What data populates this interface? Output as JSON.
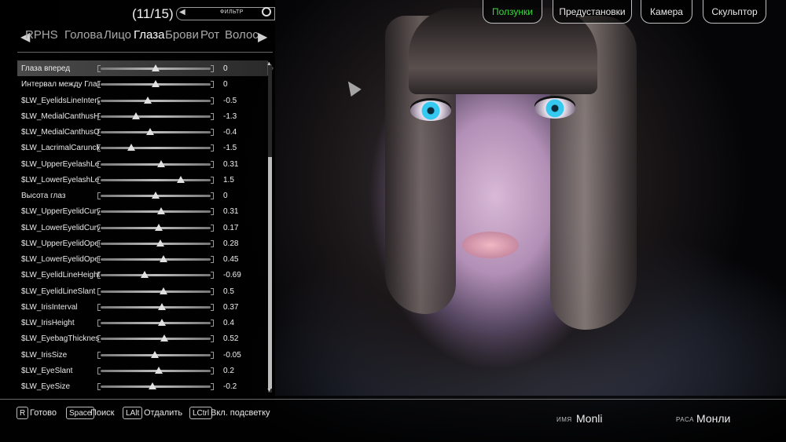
{
  "header": {
    "counter": "(11/15)",
    "filter_label": "ФИЛЬТР"
  },
  "category_tabs": [
    "RPHS",
    "Голова",
    "Лицо",
    "Глаза",
    "Брови",
    "Рот",
    "Волос"
  ],
  "active_tab": "Глаза",
  "sliders": [
    {
      "label": "Глаза вперед",
      "value": "0",
      "level": 0.5
    },
    {
      "label": "Интервал между Глазами",
      "value": "0",
      "level": 0.5
    },
    {
      "label": "$LW_EyelidsLineInterval",
      "value": "-0.5",
      "level": 0.43
    },
    {
      "label": "$LW_MedialCanthusHeight",
      "value": "-1.3",
      "level": 0.32
    },
    {
      "label": "$LW_MedialCanthusOpen",
      "value": "-0.4",
      "level": 0.45
    },
    {
      "label": "$LW_LacrimalCaruncleSize",
      "value": "-1.5",
      "level": 0.28
    },
    {
      "label": "$LW_UpperEyelashLength",
      "value": "0.31",
      "level": 0.55
    },
    {
      "label": "$LW_LowerEyelashLength",
      "value": "1.5",
      "level": 0.73
    },
    {
      "label": "Высота глаз",
      "value": "0",
      "level": 0.5
    },
    {
      "label": "$LW_UpperEyelidCurve",
      "value": "0.31",
      "level": 0.55
    },
    {
      "label": "$LW_LowerEyelidCurve",
      "value": "0.17",
      "level": 0.53
    },
    {
      "label": "$LW_UpperEyelidOpen",
      "value": "0.28",
      "level": 0.54
    },
    {
      "label": "$LW_LowerEyelidOpen",
      "value": "0.45",
      "level": 0.57
    },
    {
      "label": "$LW_EyelidLineHeight",
      "value": "-0.69",
      "level": 0.4
    },
    {
      "label": "$LW_EyelidLineSlant",
      "value": "0.5",
      "level": 0.57
    },
    {
      "label": "$LW_IrisInterval",
      "value": "0.37",
      "level": 0.56
    },
    {
      "label": "$LW_IrisHeight",
      "value": "0.4",
      "level": 0.56
    },
    {
      "label": "$LW_EyebagThickness",
      "value": "0.52",
      "level": 0.58
    },
    {
      "label": "$LW_IrisSize",
      "value": "-0.05",
      "level": 0.49
    },
    {
      "label": "$LW_EyeSlant",
      "value": "0.2",
      "level": 0.53
    },
    {
      "label": "$LW_EyeSize",
      "value": "-0.2",
      "level": 0.47
    }
  ],
  "top_menu": [
    {
      "label": "Ползунки",
      "active": true
    },
    {
      "label": "Предустановки",
      "active": false
    },
    {
      "label": "Камера",
      "active": false
    },
    {
      "label": "Скульптор",
      "active": false
    }
  ],
  "hotkeys": [
    {
      "key": "R",
      "label": "Готово"
    },
    {
      "key": "Space",
      "label": "Поиск"
    },
    {
      "key": "LAlt",
      "label": "Отдалить"
    },
    {
      "key": "LCtrl",
      "label": "Вкл. подсветку"
    }
  ],
  "character": {
    "name_caption": "ИМЯ",
    "name": "Monli",
    "race_caption": "РАСА",
    "race": "Монли"
  },
  "colors": {
    "active_menu": "#39d73f"
  },
  "icons": [
    "filter-icon",
    "arrow-left-icon",
    "arrow-right-icon",
    "scroll-up-icon",
    "scroll-down-icon",
    "cursor-icon"
  ]
}
